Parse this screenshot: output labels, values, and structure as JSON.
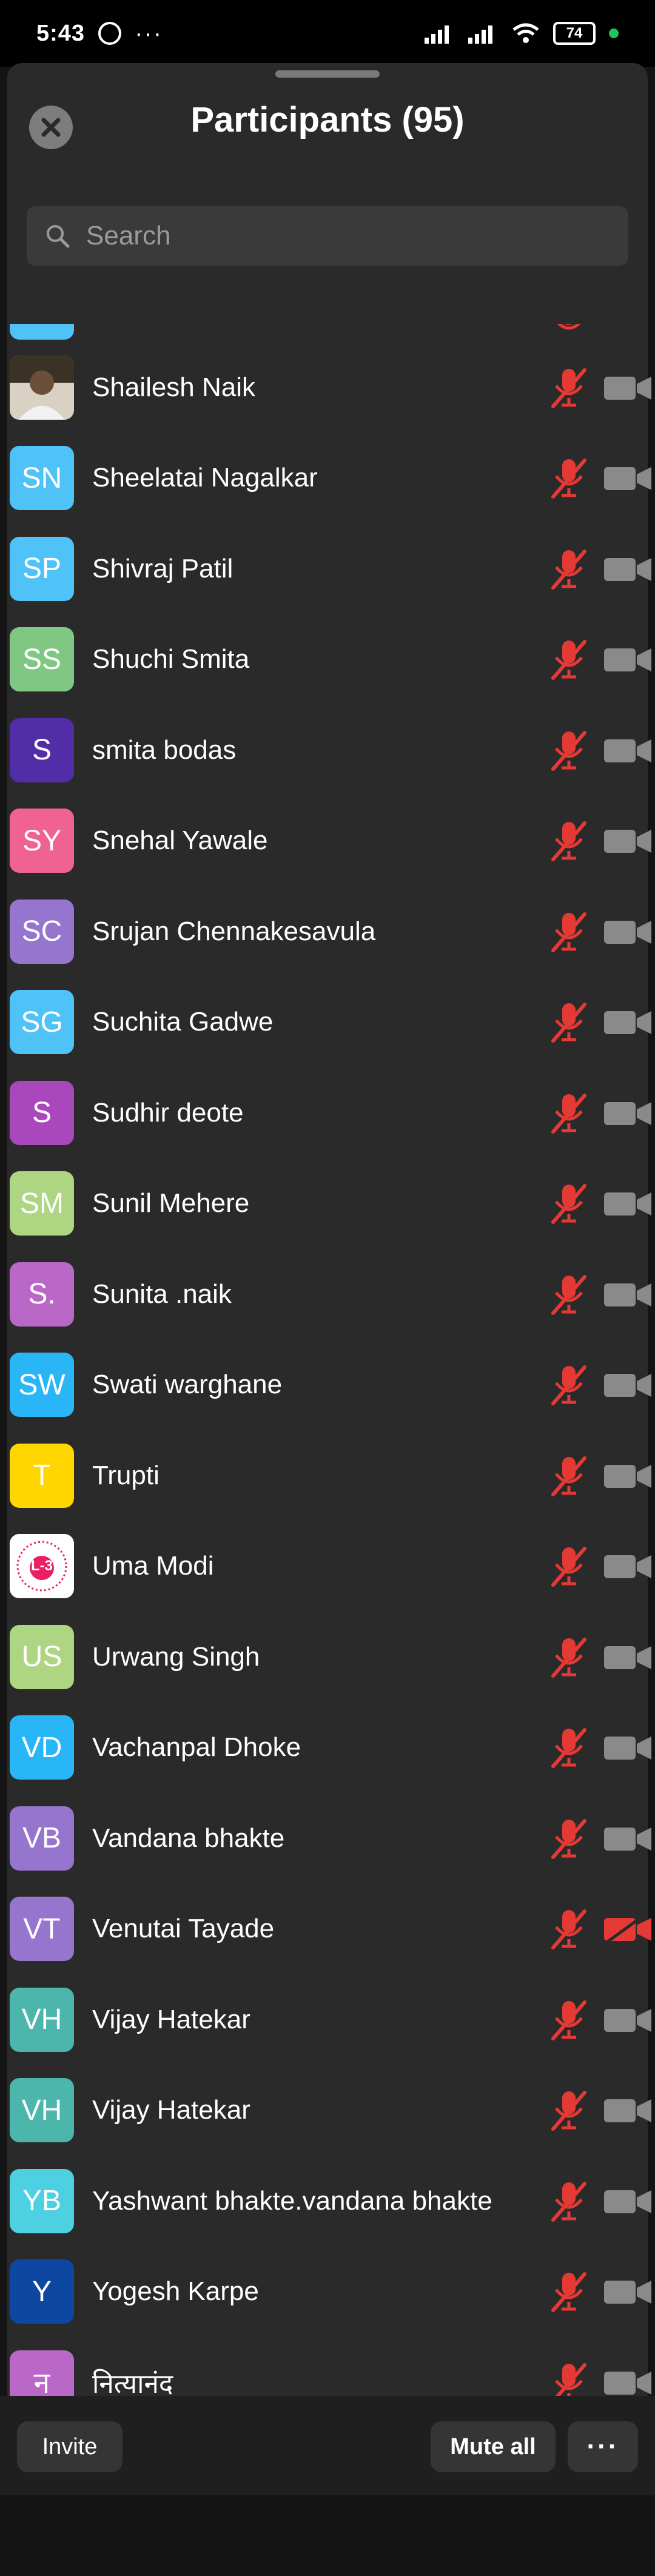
{
  "status_bar": {
    "time": "5:43",
    "battery": "74",
    "dots": "···",
    "icons": [
      "whatsapp-icon",
      "signal-icon",
      "signal-icon",
      "wifi-icon",
      "battery-icon"
    ]
  },
  "header": {
    "title": "Participants (95)",
    "close_icon": "close-icon"
  },
  "search": {
    "placeholder": "Search",
    "value": ""
  },
  "participants": [
    {
      "initials": "",
      "name": "Shailesh Naik",
      "color": "#8d7b6a",
      "photo": true,
      "video_off": false
    },
    {
      "initials": "SN",
      "name": "Sheelatai Nagalkar",
      "color": "#4fc3f7",
      "video_off": false
    },
    {
      "initials": "SP",
      "name": "Shivraj Patil",
      "color": "#4fc3f7",
      "video_off": false
    },
    {
      "initials": "SS",
      "name": "Shuchi Smita",
      "color": "#81c784",
      "video_off": false
    },
    {
      "initials": "S",
      "name": "smita bodas",
      "color": "#512da8",
      "video_off": false
    },
    {
      "initials": "SY",
      "name": "Snehal Yawale",
      "color": "#f06292",
      "video_off": false
    },
    {
      "initials": "SC",
      "name": "Srujan Chennakesavula",
      "color": "#9575cd",
      "video_off": false
    },
    {
      "initials": "SG",
      "name": "Suchita Gadwe",
      "color": "#4fc3f7",
      "video_off": false
    },
    {
      "initials": "S",
      "name": "Sudhir deote",
      "color": "#ab47bc",
      "video_off": false
    },
    {
      "initials": "SM",
      "name": "Sunil Mehere",
      "color": "#aed581",
      "video_off": false
    },
    {
      "initials": "S.",
      "name": "Sunita .naik",
      "color": "#ba68c8",
      "video_off": false
    },
    {
      "initials": "SW",
      "name": "Swati warghane",
      "color": "#29b6f6",
      "video_off": false
    },
    {
      "initials": "T",
      "name": "Trupti",
      "color": "#ffd600",
      "video_off": false
    },
    {
      "initials": "",
      "name": "Uma Modi",
      "color": "#ffffff",
      "logo": "L-3",
      "video_off": false
    },
    {
      "initials": "US",
      "name": "Urwang Singh",
      "color": "#aed581",
      "video_off": false
    },
    {
      "initials": "VD",
      "name": "Vachanpal Dhoke",
      "color": "#29b6f6",
      "video_off": false
    },
    {
      "initials": "VB",
      "name": "Vandana bhakte",
      "color": "#9575cd",
      "video_off": false
    },
    {
      "initials": "VT",
      "name": "Venutai Tayade",
      "color": "#9575cd",
      "video_off": true
    },
    {
      "initials": "VH",
      "name": "Vijay Hatekar",
      "color": "#4db6ac",
      "video_off": false
    },
    {
      "initials": "VH",
      "name": "Vijay Hatekar",
      "color": "#4db6ac",
      "video_off": false
    },
    {
      "initials": "YB",
      "name": "Yashwant bhakte.vandana bhakte",
      "color": "#4dd0e1",
      "video_off": false
    },
    {
      "initials": "Y",
      "name": "Yogesh Karpe",
      "color": "#0d47a1",
      "video_off": false
    },
    {
      "initials": "न",
      "name": "नित्यानंद",
      "color": "#ba68c8",
      "video_off": false
    }
  ],
  "bottom_bar": {
    "invite_label": "Invite",
    "mute_all_label": "Mute all",
    "more_label": "···"
  },
  "colors": {
    "muted_red": "#e53935",
    "camera_gray": "#8a8a8a",
    "sheet_bg": "#2a2a2a"
  }
}
